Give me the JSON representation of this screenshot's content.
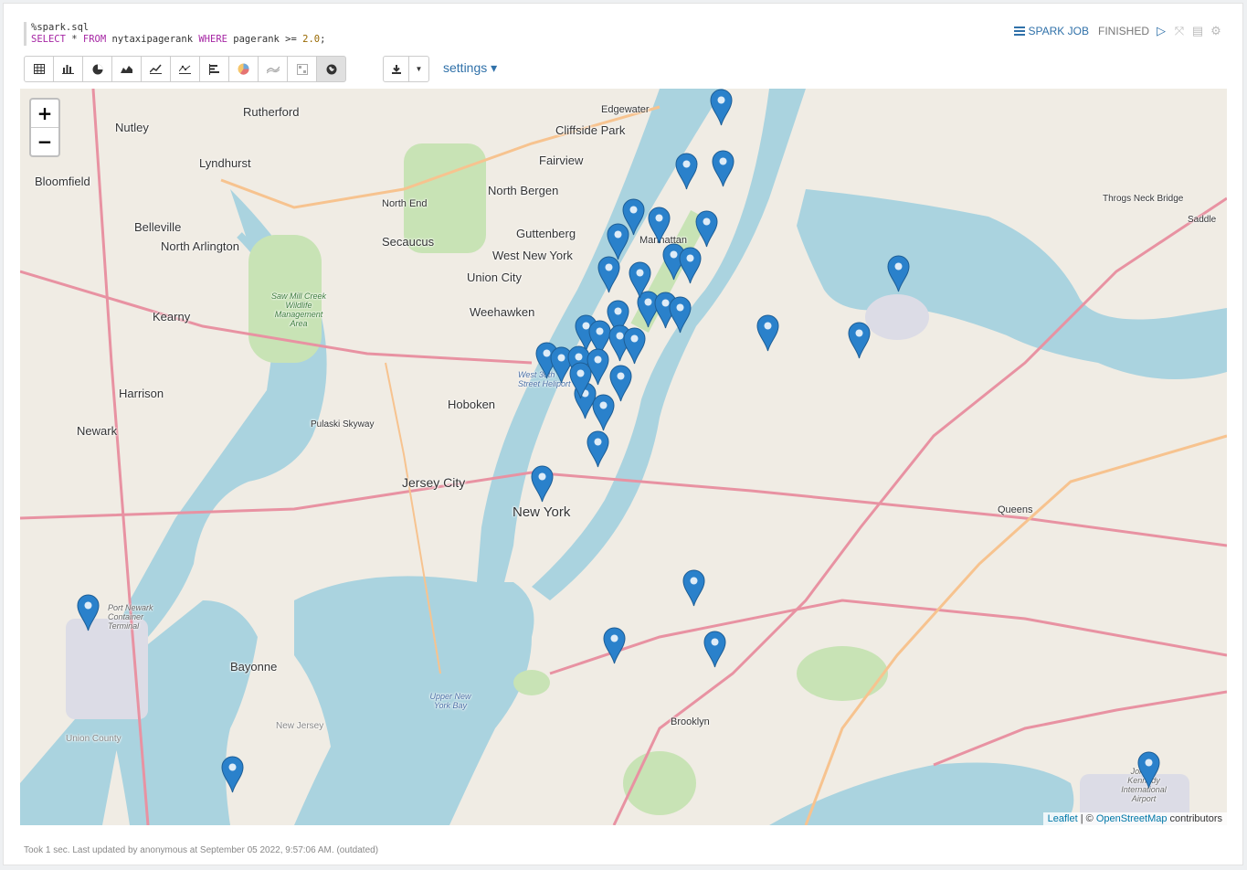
{
  "code": {
    "magic": "%spark.sql",
    "kw_select": "SELECT",
    "star": " * ",
    "kw_from": "FROM",
    "table": " nytaxipagerank ",
    "kw_where": "WHERE",
    "cond": " pagerank >= ",
    "value": "2.0",
    "end": ";"
  },
  "status": {
    "job_label": "SPARK JOB",
    "state": "FINISHED"
  },
  "toolbar": {
    "buttons": [
      "table-icon",
      "bar-chart-icon",
      "pie-chart-icon",
      "area-chart-icon",
      "line-chart-icon",
      "scatter-chart-icon",
      "horizontal-bar-icon",
      "pie-color-icon",
      "stream-chart-icon",
      "heatmap-icon",
      "map-icon"
    ],
    "settings_label": "settings ▾"
  },
  "map": {
    "zoom_in": "+",
    "zoom_out": "−",
    "attribution_leaflet": "Leaflet",
    "attribution_sep": " | © ",
    "attribution_osm": "OpenStreetMap",
    "attribution_tail": " contributors",
    "places": [
      "Rutherford",
      "Nutley",
      "Edgewater",
      "Cliffside Park",
      "Fairview",
      "Lyndhurst",
      "Bloomfield",
      "North Bergen",
      "North End",
      "Belleville",
      "Guttenberg",
      "Manhattan",
      "North Arlington",
      "Secaucus",
      "West New York",
      "Union City",
      "Kearny",
      "Weehawken",
      "Harrison",
      "Hoboken",
      "Newark",
      "Pulaski Skyway",
      "Jersey City",
      "New York",
      "Throgs Neck Bridge",
      "Queens",
      "Bayonne",
      "Brooklyn",
      "Port Newark Container Terminal",
      "Saw Mill Creek Wildlife Management Area",
      "West 30th Street Heliport",
      "Upper New York Bay",
      "John F. Kennedy International Airport",
      "Union County",
      "New Jersey",
      "Saddle"
    ],
    "marker_count": 38
  },
  "footer": "Took 1 sec. Last updated by anonymous at September 05 2022, 9:57:06 AM. (outdated)"
}
